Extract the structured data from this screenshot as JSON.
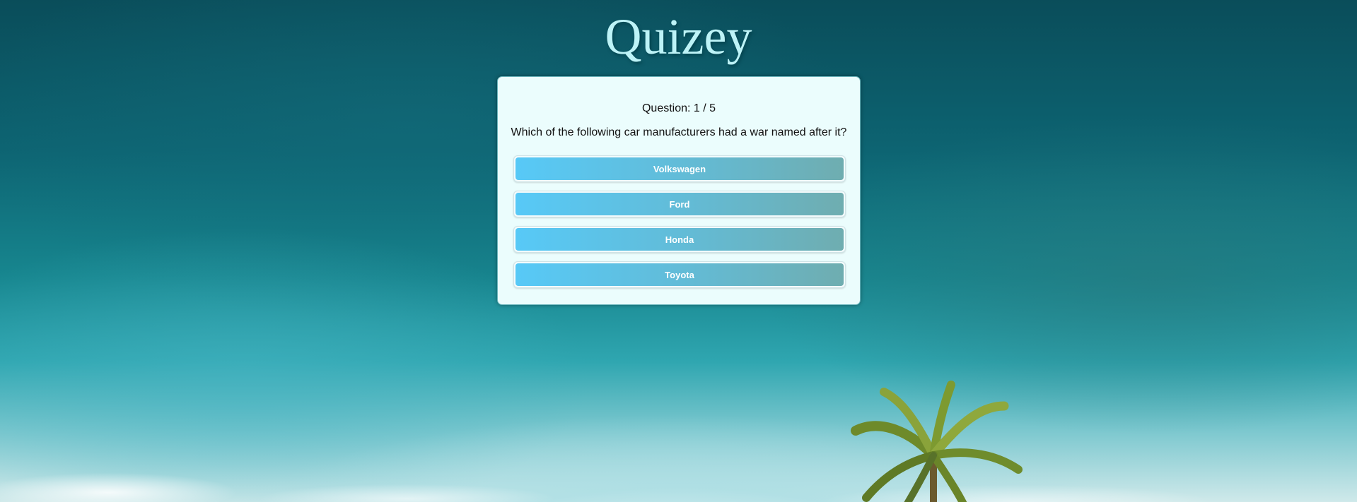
{
  "app": {
    "title": "Quizey"
  },
  "quiz": {
    "question_counter": "Question: 1 / 5",
    "question_text": "Which of the following car manufacturers had a war named after it?",
    "answers": [
      {
        "label": "Volkswagen"
      },
      {
        "label": "Ford"
      },
      {
        "label": "Honda"
      },
      {
        "label": "Toyota"
      }
    ]
  },
  "colors": {
    "title": "#bdf3f7",
    "card_background": "#ebfdfd",
    "answer_gradient_start": "#57c9f7",
    "answer_gradient_end": "#6fadb0"
  }
}
